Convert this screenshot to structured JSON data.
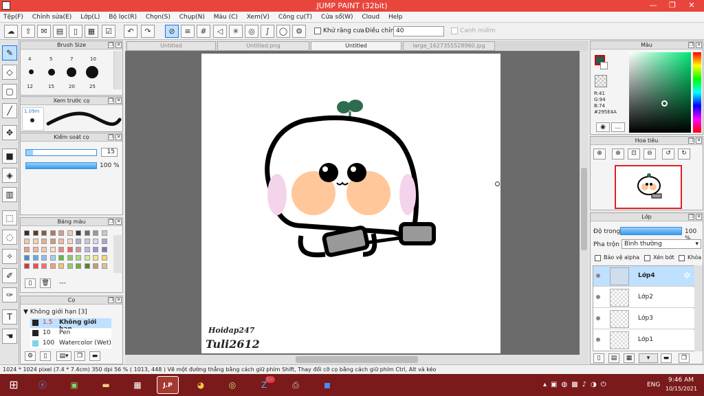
{
  "window": {
    "title": "JUMP PAINT (32bit)",
    "minimize": "—",
    "restore": "❐",
    "close": "✕"
  },
  "menu": [
    "Tệp(F)",
    "Chỉnh sửa(E)",
    "Lớp(L)",
    "Bộ lọc(R)",
    "Chọn(S)",
    "Chụp(N)",
    "Màu (C)",
    "Xem(V)",
    "Công cụ(T)",
    "Cửa sổ(W)",
    "Cloud",
    "Help"
  ],
  "toolbar": {
    "antialias_label": "Khử răng cưa",
    "adjust_label": "Điều chỉnh",
    "adjust_value": "40",
    "grid_label": "Canh miếm"
  },
  "tabs": [
    "Untitled",
    "Untitled.png",
    "Untitled",
    "large_1627355528960.jpg"
  ],
  "brush_size": {
    "title": "Brush Size",
    "sizes": [
      "4",
      "5",
      "7",
      "10",
      "12",
      "15",
      "20",
      "25"
    ]
  },
  "brush_preview": {
    "title": "Xem trước cọ",
    "size_label": "1.09m"
  },
  "brush_control": {
    "title": "Kiểm soát cọ",
    "size_value": "15",
    "opacity_value": "100 %"
  },
  "palette": {
    "title": "Bảng màu",
    "more": "---"
  },
  "brush": {
    "title": "Cọ",
    "group": "Không giới hạn [3]",
    "items": [
      {
        "size": "1.5",
        "name": "Không giới hạn"
      },
      {
        "size": "10",
        "name": "Pen"
      },
      {
        "size": "100",
        "name": "Watercolor (Wet)"
      }
    ]
  },
  "color_panel": {
    "title": "Màu",
    "r": "R:41",
    "g": "G:94",
    "b": "B:74",
    "hex": "#295E4A",
    "main_color": "#295e4a"
  },
  "navigator": {
    "title": "Hoa tiêu"
  },
  "layer_panel": {
    "title": "Lớp",
    "opacity_label": "Độ trong",
    "opacity_value": "100 %",
    "blend_label": "Pha trộn",
    "blend_value": "Bình thường",
    "protect_alpha": "Bảo vệ alpha",
    "clipping": "Xén bớt",
    "lock": "Khóa",
    "layers": [
      "Lớp4",
      "Lớp2",
      "Lớp3",
      "Lớp1"
    ]
  },
  "canvas": {
    "sign1": "Hoidap247",
    "sign2": "Tuli2612"
  },
  "status": {
    "text": "1024 * 1024 pixel   (7.4 * 7.4cm)   350 dpi   56 %   ( 1013, 448 )   Vẽ một đường thẳng bằng cách giữ phím Shift, Thay đổi cỡ cọ bằng cách giữ phím Ctrl, Alt và kéo"
  },
  "taskbar": {
    "lang": "ENG",
    "time": "9:46 AM",
    "date": "10/15/2021",
    "zalo_badge": "5+"
  }
}
